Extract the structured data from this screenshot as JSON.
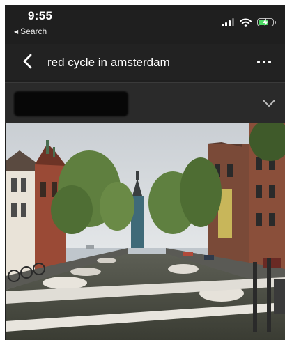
{
  "status_bar": {
    "time": "9:55",
    "back_label": "Search",
    "icons": [
      "signal-icon",
      "wifi-icon",
      "battery-charging-icon"
    ]
  },
  "search": {
    "query": "red cycle in amsterdam",
    "icons": {
      "back": "chevron-left-icon",
      "menu": "more-options-icon"
    }
  },
  "source": {
    "icons": {
      "expand": "chevron-down-icon"
    }
  },
  "image": {
    "icon": "amsterdam-canal-photo"
  },
  "colors": {
    "background": "#1f1f1f",
    "battery": "#4cd964"
  }
}
